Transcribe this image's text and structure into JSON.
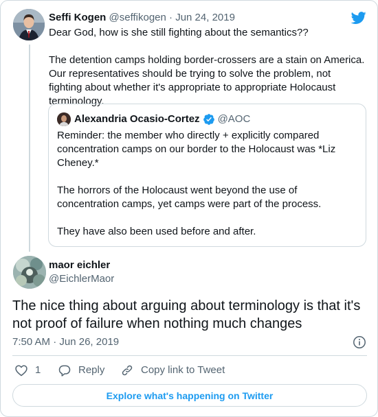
{
  "brand": {
    "logo_icon": "twitter-bird-icon",
    "color": "#1d9bf0"
  },
  "parent_tweet": {
    "author_name": "Seffi Kogen",
    "author_handle": "@seffikogen",
    "separator": "·",
    "date": "Jun 24, 2019",
    "text": "Dear God, how is she still fighting about the semantics??\n\nThe detention camps holding border-crossers are a stain on America. Our representatives should be trying to solve the problem, not fighting about whether it's appropriate to appropriate Holocaust terminology."
  },
  "quoted_tweet": {
    "author_name": "Alexandria Ocasio-Cortez",
    "verified_icon": "verified-badge-icon",
    "author_handle": "@AOC",
    "text": "Reminder: the member who directly + explicitly compared concentration camps on our border to the Holocaust was *Liz Cheney.*\n\nThe horrors of the Holocaust went beyond the use of concentration camps, yet camps were part of the process.\n\nThey have also been used before and after."
  },
  "main_tweet": {
    "author_name": "maor eichler",
    "author_handle": "@EichlerMaor",
    "text": "The nice thing about arguing about terminology is that it's not proof of failure when nothing much changes",
    "time": "7:50 AM",
    "separator": "·",
    "date": "Jun 26, 2019"
  },
  "actions": {
    "like_count": "1",
    "reply_label": "Reply",
    "copy_link_label": "Copy link to Tweet"
  },
  "footer": {
    "explore_label": "Explore what's happening on Twitter"
  }
}
